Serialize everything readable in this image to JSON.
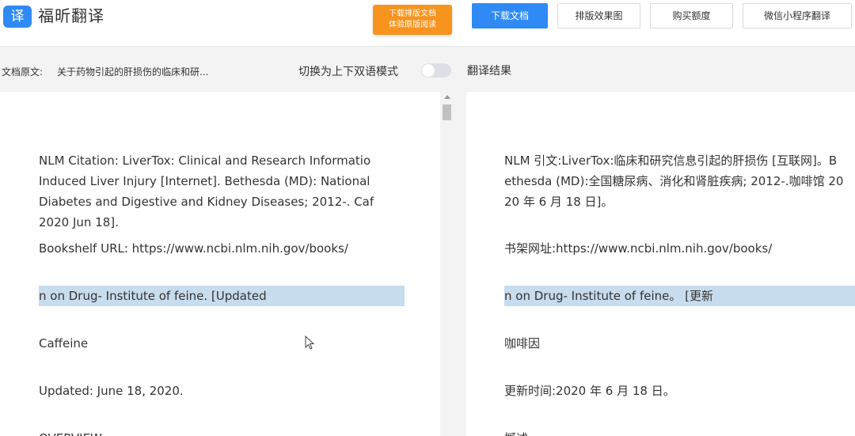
{
  "header": {
    "logo_glyph": "译",
    "brand": "福昕翻译",
    "promo_line1": "下载排版文档",
    "promo_line2": "体验原版阅读",
    "buttons": {
      "download": "下载文档",
      "layout_preview": "排版效果图",
      "buy_quota": "购买额度",
      "wechat_mini": "微信小程序翻译"
    }
  },
  "subbar": {
    "doc_label": "文档原文:",
    "doc_title": "关于药物引起的肝损伤的临床和研...",
    "mode_label": "切换为上下双语模式",
    "mode_on": false,
    "result_label": "翻译结果"
  },
  "colors": {
    "accent": "#2f8af5",
    "promo": "#f7941e",
    "highlight": "#c7dcec"
  },
  "source": {
    "citation": "NLM Citation: LiverTox: Clinical and Research Informatio Induced Liver Injury [Internet]. Bethesda (MD): National Diabetes and Digestive and Kidney Diseases; 2012-. Caf 2020 Jun 18].",
    "url": "Bookshelf URL: https://www.ncbi.nlm.nih.gov/books/",
    "highlight": "n on Drug- Institute of feine. [Updated",
    "title": "Caffeine",
    "updated": "Updated: June 18, 2020.",
    "overview": "OVERVIEW"
  },
  "translation": {
    "citation_l1": "NLM 引文:LiverTox:临床和研究信息引起的肝损伤 [互联网]。B",
    "citation_l2": "ethesda (MD):全国糖尿病、消化和肾脏疾病; 2012-.咖啡馆 20",
    "citation_l3": "20 年 6 月 18 日]。",
    "url": "书架网址:https://www.ncbi.nlm.nih.gov/books/",
    "highlight": "n on Drug- Institute of feine。 [更新",
    "title": "咖啡因",
    "updated": "更新时间:2020 年 6 月 18 日。",
    "overview": "概述"
  }
}
